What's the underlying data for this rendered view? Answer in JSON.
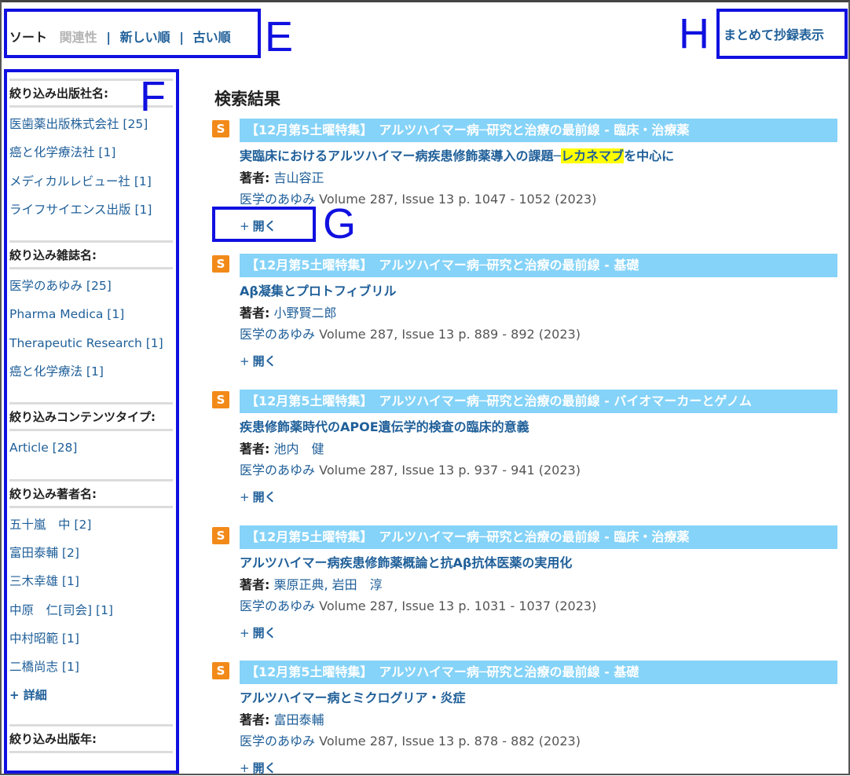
{
  "sort": {
    "label": "ソート",
    "options": [
      "関連性",
      "新しい順",
      "古い順"
    ],
    "separator": "|"
  },
  "bulk_view_label": "まとめて抄録表示",
  "facets": [
    {
      "heading": "絞り込み出版社名:",
      "items": [
        "医歯薬出版株式会社 [25]",
        "癌と化学療法社 [1]",
        "メディカルレビュー社 [1]",
        "ライフサイエンス出版 [1]"
      ]
    },
    {
      "heading": "絞り込み雑誌名:",
      "items": [
        "医学のあゆみ [25]",
        "Pharma Medica [1]",
        "Therapeutic Research [1]",
        "癌と化学療法 [1]"
      ]
    },
    {
      "heading": "絞り込みコンテンツタイプ:",
      "items": [
        "Article [28]"
      ]
    },
    {
      "heading": "絞り込み著者名:",
      "items": [
        "五十嵐　中 [2]",
        "富田泰輔 [2]",
        "三木幸雄 [1]",
        "中原　仁[司会] [1]",
        "中村昭範 [1]",
        "二橋尚志 [1]"
      ],
      "more": "+ 詳細"
    },
    {
      "heading": "絞り込み出版年:",
      "items": []
    }
  ],
  "results_title": "検索結果",
  "results": [
    {
      "badge": "S",
      "banner": "【12月第5土曜特集】　アルツハイマー病─研究と治療の最前線 - 臨床・治療薬",
      "title_pre": "実臨床におけるアルツハイマー病疾患修飾薬導入の課題─",
      "title_hl": "レカネマブ",
      "title_post": "を中心に",
      "author_label": "著者:",
      "authors": "吉山容正",
      "journal": "医学のあゆみ",
      "citation": "Volume 287, Issue 13 p. 1047 - 1052 (2023)",
      "open": "開く"
    },
    {
      "badge": "S",
      "banner": "【12月第5土曜特集】　アルツハイマー病─研究と治療の最前線 - 基礎",
      "title_pre": "Aβ凝集とプロトフィブリル",
      "title_hl": "",
      "title_post": "",
      "author_label": "著者:",
      "authors": "小野賢二郎",
      "journal": "医学のあゆみ",
      "citation": "Volume 287, Issue 13 p. 889 - 892 (2023)",
      "open": "開く"
    },
    {
      "badge": "S",
      "banner": "【12月第5土曜特集】　アルツハイマー病─研究と治療の最前線 - バイオマーカーとゲノム",
      "title_pre": "疾患修飾薬時代のAPOE遺伝学的検査の臨床的意義",
      "title_hl": "",
      "title_post": "",
      "author_label": "著者:",
      "authors": "池内　健",
      "journal": "医学のあゆみ",
      "citation": "Volume 287, Issue 13 p. 937 - 941 (2023)",
      "open": "開く"
    },
    {
      "badge": "S",
      "banner": "【12月第5土曜特集】　アルツハイマー病─研究と治療の最前線 - 臨床・治療薬",
      "title_pre": "アルツハイマー病疾患修飾薬概論と抗Aβ抗体医薬の実用化",
      "title_hl": "",
      "title_post": "",
      "author_label": "著者:",
      "authors": "栗原正典,  岩田　淳",
      "journal": "医学のあゆみ",
      "citation": "Volume 287, Issue 13 p. 1031 - 1037 (2023)",
      "open": "開く"
    },
    {
      "badge": "S",
      "banner": "【12月第5土曜特集】　アルツハイマー病─研究と治療の最前線 - 基礎",
      "title_pre": "アルツハイマー病とミクログリア・炎症",
      "title_hl": "",
      "title_post": "",
      "author_label": "著者:",
      "authors": "富田泰輔",
      "journal": "医学のあゆみ",
      "citation": "Volume 287, Issue 13 p. 878 - 882 (2023)",
      "open": "開く"
    }
  ],
  "annotations": {
    "E": "E",
    "F": "F",
    "G": "G",
    "H": "H"
  },
  "colors": {
    "link": "#1f5f99",
    "banner": "#85d3f8",
    "badge": "#f28a1a",
    "highlight": "#ffff00",
    "annotation": "#1010e0"
  }
}
